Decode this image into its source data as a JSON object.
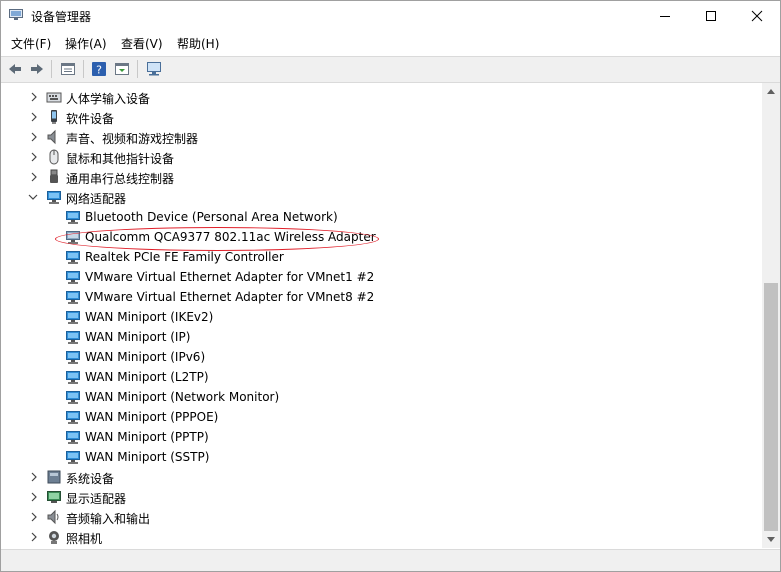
{
  "window": {
    "title": "设备管理器"
  },
  "menu": [
    "文件(F)",
    "操作(A)",
    "查看(V)",
    "帮助(H)"
  ],
  "tree": {
    "categories_before": [
      {
        "label": "人体学输入设备",
        "icon": "hid-icon",
        "expanded": false
      },
      {
        "label": "软件设备",
        "icon": "software-device-icon",
        "expanded": false
      },
      {
        "label": "声音、视频和游戏控制器",
        "icon": "speaker-icon",
        "expanded": false
      },
      {
        "label": "鼠标和其他指针设备",
        "icon": "mouse-icon",
        "expanded": false
      },
      {
        "label": "通用串行总线控制器",
        "icon": "usb-icon",
        "expanded": false
      }
    ],
    "network": {
      "label": "网络适配器",
      "icon": "network-adapter-icon",
      "expanded": true,
      "children": [
        "Bluetooth Device (Personal Area Network)",
        "Qualcomm QCA9377 802.11ac Wireless Adapter",
        "Realtek PCIe FE Family Controller",
        "VMware Virtual Ethernet Adapter for VMnet1 #2",
        "VMware Virtual Ethernet Adapter for VMnet8 #2",
        "WAN Miniport (IKEv2)",
        "WAN Miniport (IP)",
        "WAN Miniport (IPv6)",
        "WAN Miniport (L2TP)",
        "WAN Miniport (Network Monitor)",
        "WAN Miniport (PPPOE)",
        "WAN Miniport (PPTP)",
        "WAN Miniport (SSTP)"
      ]
    },
    "categories_after": [
      {
        "label": "系统设备",
        "icon": "system-device-icon",
        "expanded": false
      },
      {
        "label": "显示适配器",
        "icon": "display-adapter-icon",
        "expanded": false
      },
      {
        "label": "音频输入和输出",
        "icon": "audio-icon",
        "expanded": false
      },
      {
        "label": "照相机",
        "icon": "camera-icon",
        "expanded": false
      }
    ]
  },
  "colors": {
    "highlight": "#e0202a",
    "net_icon": "#2f8fd8"
  }
}
